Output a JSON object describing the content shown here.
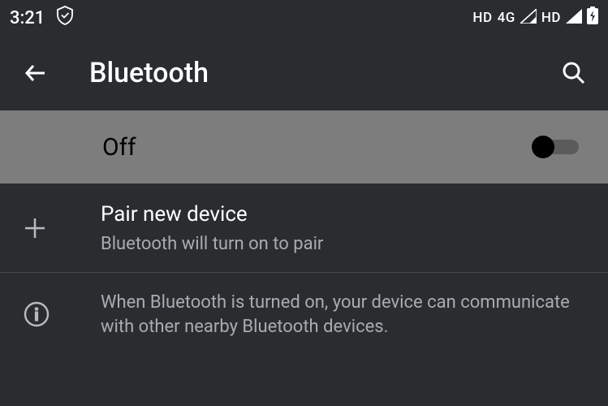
{
  "status": {
    "time": "3:21",
    "hd1": "HD",
    "net": "4G",
    "hd2": "HD"
  },
  "appbar": {
    "title": "Bluetooth"
  },
  "toggle": {
    "state_label": "Off",
    "on": false
  },
  "pair": {
    "title": "Pair new device",
    "subtitle": "Bluetooth will turn on to pair"
  },
  "info": {
    "text": "When Bluetooth is turned on, your device can communicate with other nearby Bluetooth devices."
  }
}
